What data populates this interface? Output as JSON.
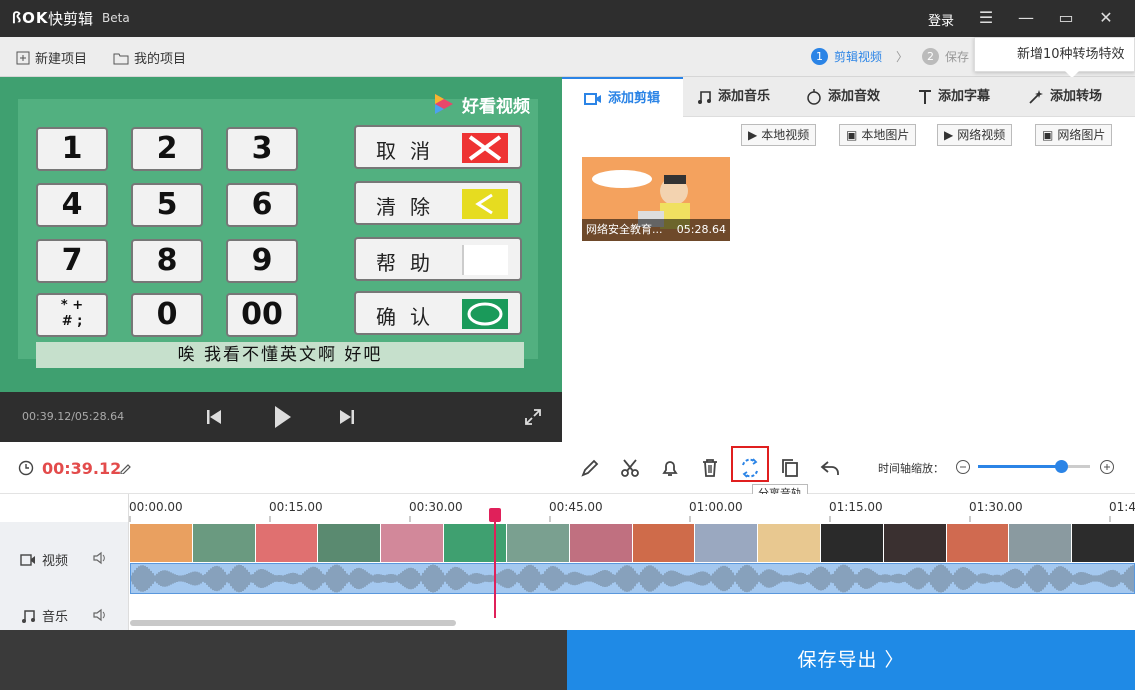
{
  "app": {
    "logo": "ꟗOK",
    "name": "快剪辑",
    "beta": "Beta",
    "login": "登录"
  },
  "toolbar": {
    "new_project": "新建项目",
    "my_projects": "我的项目"
  },
  "steps": [
    {
      "num": "1",
      "label": "剪辑视频"
    },
    {
      "num": "2",
      "label": "保存"
    }
  ],
  "top_tooltip": "新增10种转场特效",
  "preview": {
    "keys": [
      "1",
      "2",
      "3",
      "4",
      "5",
      "6",
      "7",
      "8",
      "9",
      "* +\n# ;",
      "0",
      "00"
    ],
    "fkeys": [
      "取消",
      "清除",
      "帮助",
      "确认"
    ],
    "subtitle": "唉  我看不懂英文啊  好吧",
    "watermark": "好看视频",
    "time": "00:39.12/05:28.64"
  },
  "tabs": [
    "添加剪辑",
    "添加音乐",
    "添加音效",
    "添加字幕",
    "添加转场"
  ],
  "sources": [
    "本地视频",
    "本地图片",
    "网络视频",
    "网络图片"
  ],
  "media": {
    "title": "网络安全教育...",
    "duration": "05:28.64"
  },
  "edit": {
    "time": "00:39.12",
    "zoom_label": "时间轴缩放：",
    "zoom_level": 0.74,
    "tooltip": "分离音轨"
  },
  "ruler": [
    "00:00.00",
    "00:15.00",
    "00:30.00",
    "00:45.00",
    "01:00.00",
    "01:15.00",
    "01:30.00",
    "01:4"
  ],
  "tracks": {
    "video": "视频",
    "music": "音乐"
  },
  "export": "保存导出 〉",
  "colors": {
    "accent": "#2b84e6",
    "time": "#e34b4b",
    "highlight": "#e01f1f"
  }
}
